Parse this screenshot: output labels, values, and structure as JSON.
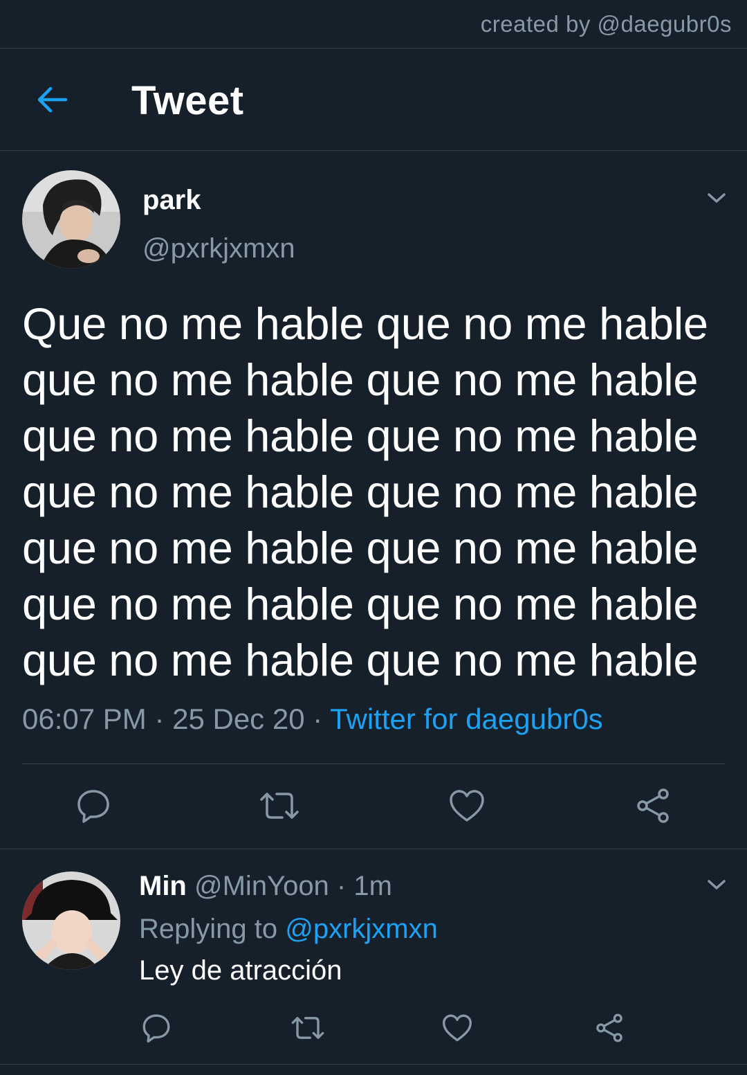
{
  "credit": "created by @daegubr0s",
  "header": {
    "title": "Tweet"
  },
  "tweet": {
    "author_name": "park",
    "author_handle": "@pxrkjxmxn",
    "text": "Que no me hable que no me hable que no me hable que no me hable que no me hable que no me hable que no me hable que no me hable que no me hable que no me hable que no me hable que no me hable que no me hable que no me hable",
    "time": "06:07 PM",
    "sep1": " · ",
    "date": "25 Dec 20",
    "sep2": " · ",
    "source": "Twitter for daegubr0s"
  },
  "reply": {
    "author_name": "Min",
    "author_handle": "@MinYoon",
    "sep": " · ",
    "time": "1m",
    "replying_prefix": "Replying to ",
    "replying_handle": "@pxrkjxmxn",
    "text": "Ley de atracción"
  },
  "colors": {
    "background": "#15202b",
    "accent": "#1da1f2",
    "muted": "#8899a6",
    "divider": "#38444d"
  },
  "icons": {
    "back": "arrow-left-icon",
    "more": "chevron-down-icon",
    "reply": "comment-bubble-icon",
    "retweet": "retweet-icon",
    "like": "heart-icon",
    "share": "share-icon"
  }
}
